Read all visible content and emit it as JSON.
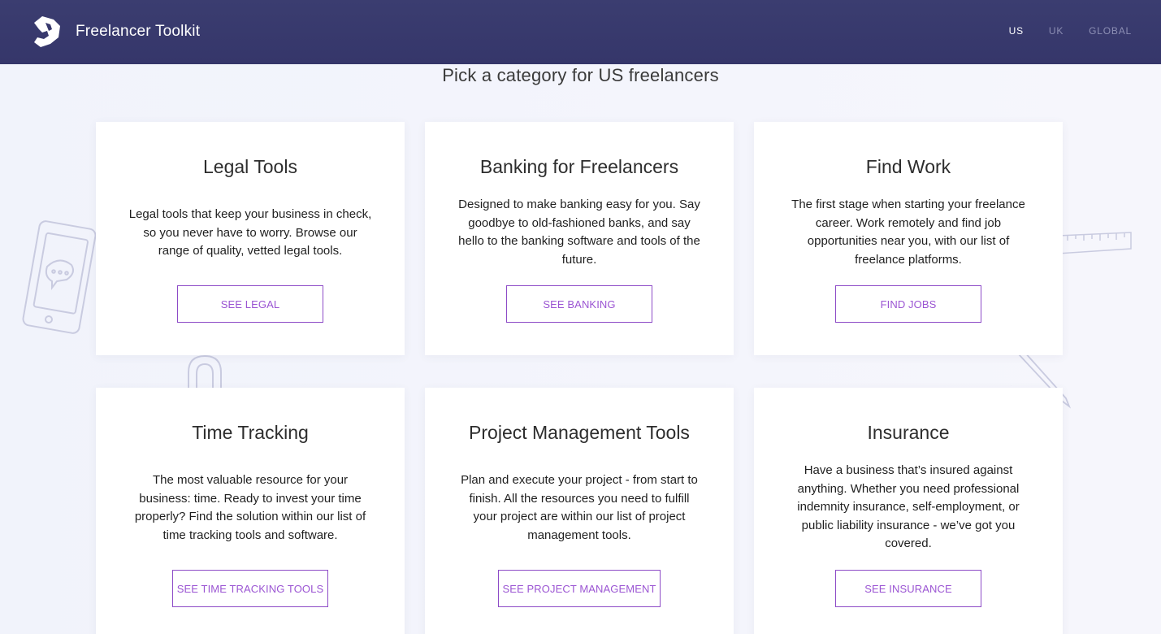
{
  "header": {
    "brand_name": "Freelancer Toolkit",
    "logo_icon": "wrench-fist-logo-icon",
    "regions": [
      {
        "label": "US",
        "active": true
      },
      {
        "label": "UK",
        "active": false
      },
      {
        "label": "GLOBAL",
        "active": false
      }
    ]
  },
  "main": {
    "headline": "Pick a category for US freelancers",
    "cards": [
      {
        "title": "Legal Tools",
        "description": "Legal tools that keep your business in check, so you never have to worry. Browse our range of quality, vetted legal tools.",
        "button": "SEE LEGAL"
      },
      {
        "title": "Banking for Freelancers",
        "description": "Designed to make banking easy for you. Say goodbye to old-fashioned banks, and say hello to the banking software and tools of the future.",
        "button": "SEE BANKING"
      },
      {
        "title": "Find Work",
        "description": "The first stage when starting your freelance career. Work remotely and find job opportunities near you, with our list of freelance platforms.",
        "button": "FIND JOBS"
      },
      {
        "title": "Time Tracking",
        "description": "The most valuable resource for your business: time. Ready to invest your time properly? Find the solution within our list of time tracking tools and software.",
        "button": "SEE TIME TRACKING TOOLS"
      },
      {
        "title": "Project Management Tools",
        "description": "Plan and execute your project - from start to finish. All the resources you need to fulfill your project are within our list of project management tools.",
        "button": "SEE PROJECT MANAGEMENT"
      },
      {
        "title": "Insurance",
        "description": "Have a business that’s insured against anything. Whether you need professional indemnity insurance, self-employment, or public liability insurance - we’ve got you covered.",
        "button": "SEE INSURANCE"
      }
    ]
  },
  "colors": {
    "header_bg": "#37386c",
    "accent": "#9b55d3",
    "page_bg": "#f3f4fb"
  }
}
